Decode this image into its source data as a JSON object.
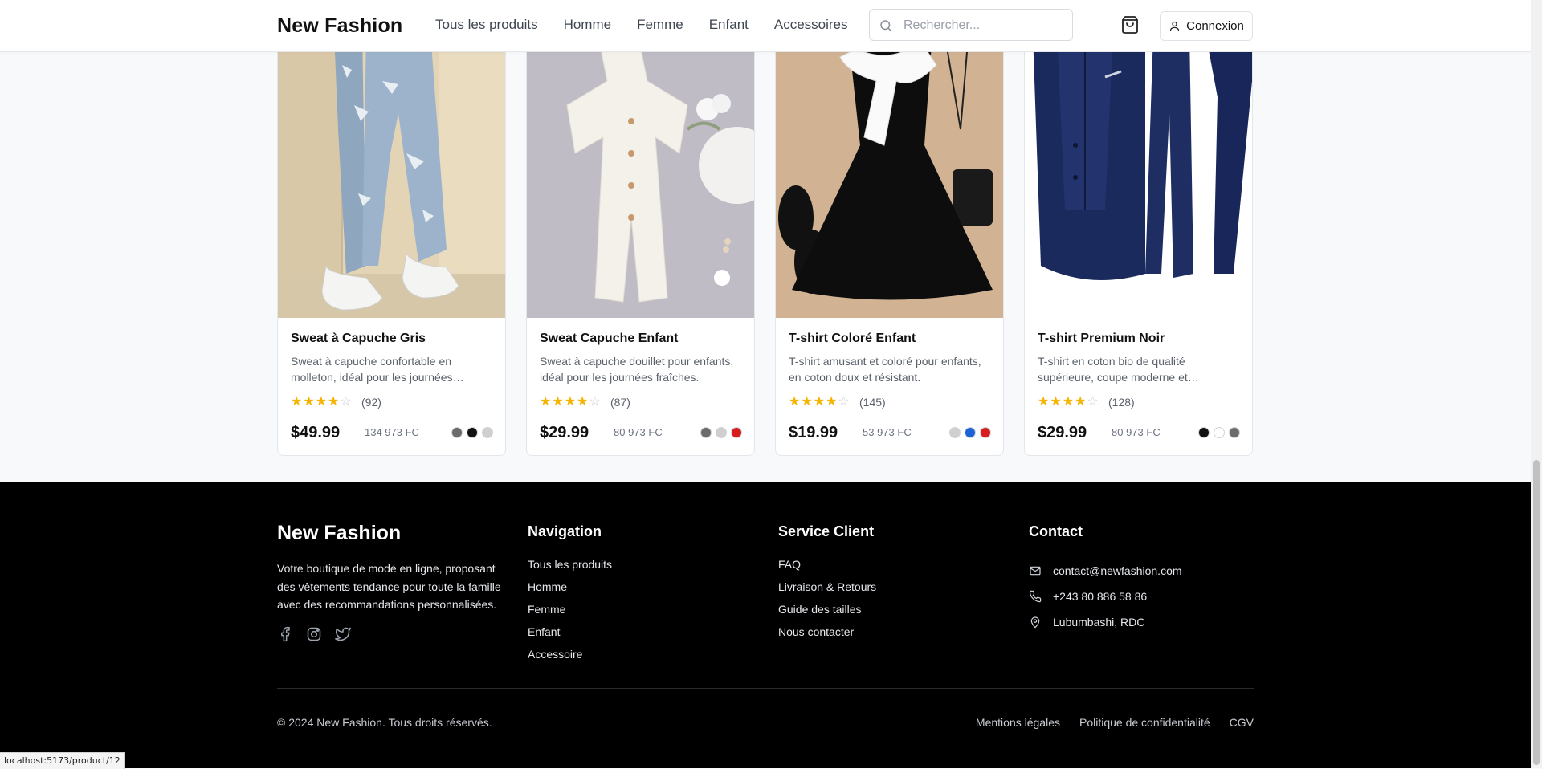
{
  "header": {
    "logo": "New Fashion",
    "nav": [
      "Tous les produits",
      "Homme",
      "Femme",
      "Enfant",
      "Accessoires"
    ],
    "search_placeholder": "Rechercher...",
    "login_label": "Connexion",
    "icons": [
      "search-icon",
      "cart-icon",
      "user-icon"
    ]
  },
  "products": [
    {
      "title": "Sweat à Capuche Gris",
      "description": "Sweat à capuche confortable en molleton, idéal pour les journées fraîches.",
      "rating": 4,
      "reviews": "(92)",
      "price": "$49.99",
      "price_fc": "134 973 FC",
      "colors": [
        "#6b6b6b",
        "#111111",
        "#cfcfcf"
      ]
    },
    {
      "title": "Sweat Capuche Enfant",
      "description": "Sweat à capuche douillet pour enfants, idéal pour les journées fraîches.",
      "rating": 4,
      "reviews": "(87)",
      "price": "$29.99",
      "price_fc": "80 973 FC",
      "colors": [
        "#6b6b6b",
        "#cfcfcf",
        "#d91c1c"
      ]
    },
    {
      "title": "T-shirt Coloré Enfant",
      "description": "T-shirt amusant et coloré pour enfants, en coton doux et résistant.",
      "rating": 4,
      "reviews": "(145)",
      "price": "$19.99",
      "price_fc": "53 973 FC",
      "colors": [
        "#cfcfcf",
        "#1d63d8",
        "#d91c1c"
      ]
    },
    {
      "title": "T-shirt Premium Noir",
      "description": "T-shirt en coton bio de qualité supérieure, coupe moderne et confortable.",
      "rating": 4,
      "reviews": "(128)",
      "price": "$29.99",
      "price_fc": "80 973 FC",
      "colors": [
        "#111111",
        "#ffffff",
        "#6b6b6b"
      ]
    }
  ],
  "footer": {
    "logo": "New Fashion",
    "about": "Votre boutique de mode en ligne, proposant des vêtements tendance pour toute la famille avec des recommandations personnalisées.",
    "social_icons": [
      "facebook-icon",
      "instagram-icon",
      "twitter-icon"
    ],
    "navigation": {
      "title": "Navigation",
      "links": [
        "Tous les produits",
        "Homme",
        "Femme",
        "Enfant",
        "Accessoire"
      ]
    },
    "service": {
      "title": "Service Client",
      "links": [
        "FAQ",
        "Livraison & Retours",
        "Guide des tailles",
        "Nous contacter"
      ]
    },
    "contact": {
      "title": "Contact",
      "email": "contact@newfashion.com",
      "phone": "+243 80 886 58 86",
      "address": "Lubumbashi, RDC"
    },
    "copyright": "© 2024 New Fashion. Tous droits réservés.",
    "legal": [
      "Mentions légales",
      "Politique de confidentialité",
      "CGV"
    ]
  },
  "status_url": "localhost:5173/product/12",
  "colors": {
    "star": "#f5b400",
    "footer_bg": "#000000",
    "page_bg": "#f8f9fb"
  }
}
